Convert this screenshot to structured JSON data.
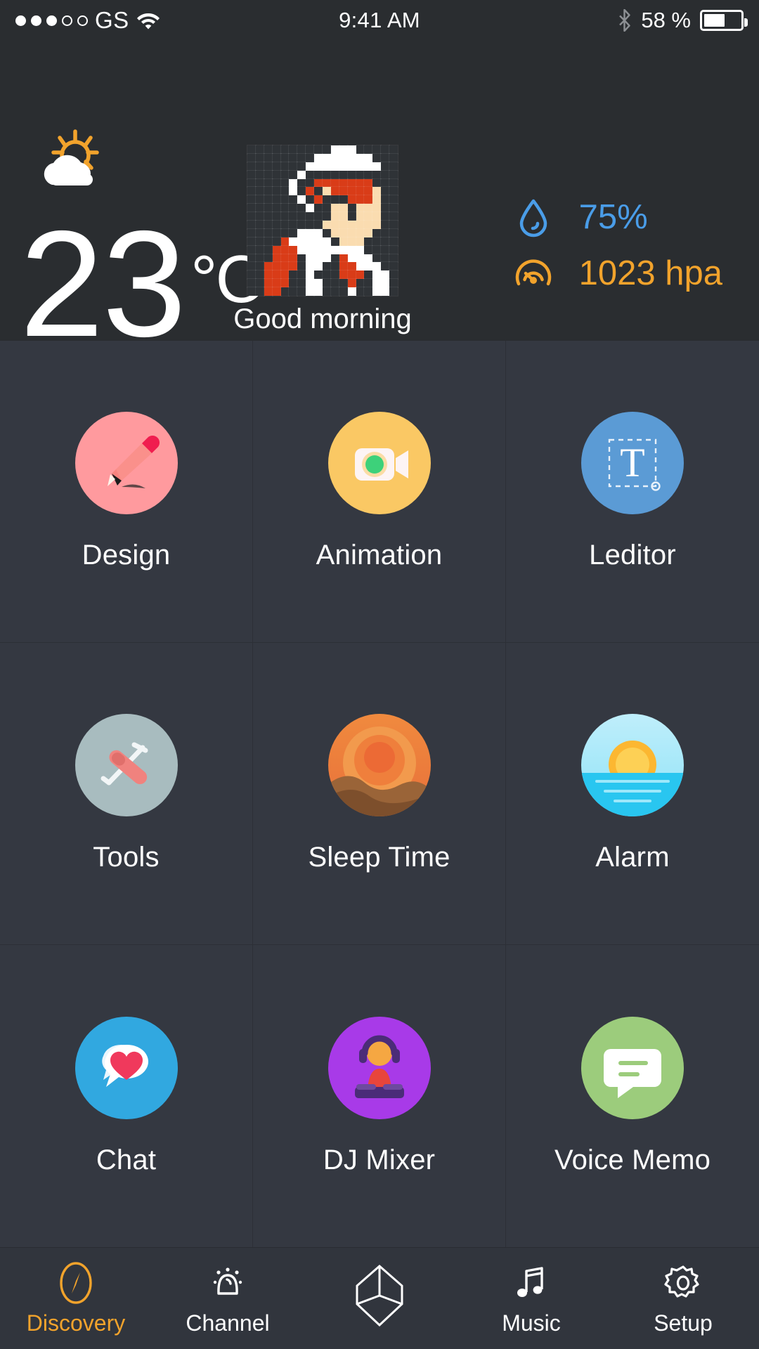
{
  "status_bar": {
    "signal_dots_total": 5,
    "signal_dots_filled": 3,
    "carrier": "GS",
    "wifi_icon": "wifi-icon",
    "time": "9:41 AM",
    "bluetooth_icon": "bluetooth-icon",
    "battery_text": "58 %",
    "battery_percent": 58
  },
  "weather": {
    "condition_icon": "sun-behind-cloud-icon",
    "temperature": "23",
    "unit": "°C",
    "greeting": "Good morning",
    "avatar_icon": "pixel-art-avatar",
    "metrics": [
      {
        "icon": "water-drop-icon",
        "value": "75%",
        "color": "#4a9de8"
      },
      {
        "icon": "gauge-icon",
        "value": "1023 hpa",
        "color": "#f2a32c"
      }
    ]
  },
  "apps": [
    {
      "label": "Design",
      "icon": "pencil-icon",
      "bg": "#ff9a9e"
    },
    {
      "label": "Animation",
      "icon": "video-camera-icon",
      "bg": "#fac864"
    },
    {
      "label": "Leditor",
      "icon": "text-tool-icon",
      "bg": "#5b9bd5"
    },
    {
      "label": "Tools",
      "icon": "swiss-knife-icon",
      "bg": "#a8bcbf"
    },
    {
      "label": "Sleep Time",
      "icon": "sunset-dune-icon",
      "bg": "#e8733c"
    },
    {
      "label": "Alarm",
      "icon": "sunrise-sea-icon",
      "bg": "#29c6f0"
    },
    {
      "label": "Chat",
      "icon": "heart-bubble-icon",
      "bg": "#31a8e0"
    },
    {
      "label": "DJ Mixer",
      "icon": "dj-icon",
      "bg": "#a83ae8"
    },
    {
      "label": "Voice Memo",
      "icon": "speech-bubble-icon",
      "bg": "#9ccc7c"
    }
  ],
  "tabbar": {
    "active_color": "#f2a32c",
    "items": [
      {
        "label": "Discovery",
        "icon": "compass-icon",
        "active": true
      },
      {
        "label": "Channel",
        "icon": "bell-icon",
        "active": false
      },
      {
        "label": "",
        "icon": "cube-icon",
        "active": false
      },
      {
        "label": "Music",
        "icon": "music-note-icon",
        "active": false
      },
      {
        "label": "Setup",
        "icon": "gear-icon",
        "active": false
      }
    ]
  },
  "avatar_pixels": [
    "..........WWW.....",
    "........WWWWWWW...",
    ".......WWWWWWWWW..",
    "......W...........",
    ".....W..RRRRRRR...",
    ".....W.R.SRRRRRS..",
    "......W.R...RRRS..",
    ".......W..SS.SSS..",
    "..........SS.SSS..",
    ".........SSSSSSS..",
    "......WWW.SSSSS...",
    "....RWWWWW.SSS....",
    "...RRRWWWWWWWW....",
    "...RRR.WWW.RWWW...",
    "..RRRR.WW..RRWWW..",
    "..RRR..W...RRR.WW.",
    "..RRR..WW...R..WW.",
    "..RR...WW...W..WW."
  ]
}
